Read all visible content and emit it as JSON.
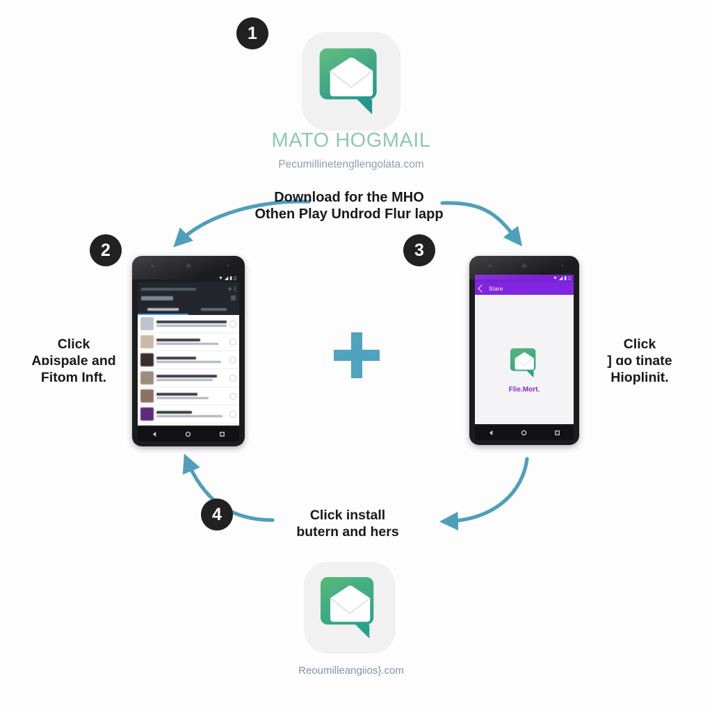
{
  "page": {
    "background_color": "#fdfdfd",
    "accent_color": "#50a3be",
    "badge_color": "#212121"
  },
  "brand": {
    "name": "MATO HOGMAIL",
    "name_color": "#8ec9b4",
    "url": "Pecumillinetengllengolata.com",
    "url_color": "#8e9fb0",
    "icon": "mail-speech-bubble-icon"
  },
  "footer": {
    "url": "Reoumilleangiios}.com",
    "url_color": "#7f93ab",
    "icon": "mail-speech-bubble-icon"
  },
  "steps": [
    {
      "number": "1",
      "caption_lines": [
        "Download for the MHO",
        "Othen Play Undrod Flur lapp"
      ]
    },
    {
      "number": "2",
      "caption_lines": [
        "Click",
        "Aɒispale and",
        "Fitom Inft."
      ]
    },
    {
      "number": "3",
      "caption_lines": [
        "Click",
        "] ɑo tinate",
        "Hioplinit."
      ]
    },
    {
      "number": "4",
      "caption_lines": [
        "Click install",
        "butern and hers"
      ]
    }
  ],
  "plus_symbol": {
    "name": "plus-sign",
    "color": "#50a3be"
  },
  "arrows": [
    {
      "name": "arrow-step1-to-step2",
      "direction": "down-left",
      "color": "#4e9fbb"
    },
    {
      "name": "arrow-step1-to-step3",
      "direction": "down-right",
      "color": "#4e9fbb"
    },
    {
      "name": "arrow-step4-to-step2",
      "direction": "up-left",
      "color": "#4e9fbb"
    },
    {
      "name": "arrow-step3-to-step4",
      "direction": "down-left",
      "color": "#4e9fbb"
    }
  ],
  "phone_left": {
    "name": "android-phone-app-list",
    "screen_type": "app-store-list",
    "statusbar_glyphs": "▼◢▮▯",
    "tab_indicator_color": "#4a8fd8",
    "header_background": "#23262c",
    "rows": [
      {
        "thumb_color": "#b9c4cf"
      },
      {
        "thumb_color": "#c9b9a8"
      },
      {
        "thumb_color": "#3a2e2c"
      },
      {
        "thumb_color": "#9c8c80"
      },
      {
        "thumb_color": "#8d7163"
      },
      {
        "thumb_color": "#5c2a78"
      },
      {
        "thumb_color": "#c2b0a2"
      }
    ]
  },
  "phone_right": {
    "name": "android-phone-app-detail",
    "screen_type": "app-store-detail",
    "appbar_color": "#8125e0",
    "appbar_title": "Stare",
    "app_name": "Flie.Mort.",
    "app_name_color": "#8b28cf",
    "app_icon": "mail-speech-bubble-icon"
  },
  "nav_icons": [
    "back-triangle-icon",
    "home-circle-icon",
    "recents-square-icon"
  ]
}
